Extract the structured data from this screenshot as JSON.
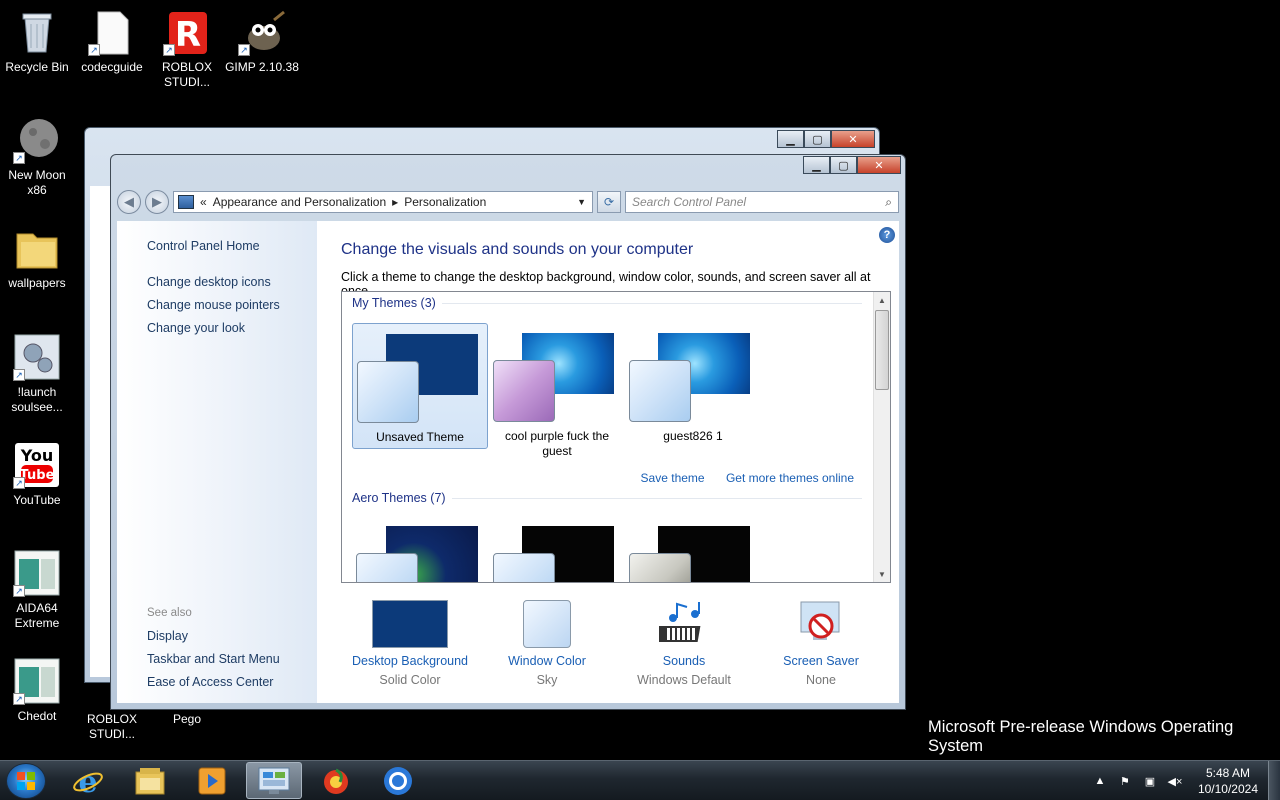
{
  "desktop": {
    "icons": [
      {
        "label": "Recycle Bin",
        "icon": "recycle-bin-icon"
      },
      {
        "label": "codecguide",
        "icon": "document-icon"
      },
      {
        "label": "ROBLOX STUDI...",
        "icon": "roblox-icon"
      },
      {
        "label": "GIMP 2.10.38",
        "icon": "gimp-icon"
      },
      {
        "label": "New Moon x86",
        "icon": "moon-icon"
      },
      {
        "label": "wallpapers",
        "icon": "folder-icon"
      },
      {
        "label": "!launch soulsee...",
        "icon": "gears-icon"
      },
      {
        "label": "YouTube",
        "icon": "youtube-icon"
      },
      {
        "label": "AIDA64 Extreme",
        "icon": "aida64-icon"
      },
      {
        "label": "Chedot",
        "icon": "chedot-icon"
      },
      {
        "label": "ROBLOX STUDI...",
        "icon": "roblox-icon"
      },
      {
        "label": "Pego",
        "icon": "app-icon"
      }
    ],
    "watermark": "Microsoft Pre-release Windows Operating System"
  },
  "window": {
    "address": {
      "chevron": "«",
      "crumb1": "Appearance and Personalization",
      "separator": "▸",
      "crumb2": "Personalization"
    },
    "search_placeholder": "Search Control Panel",
    "left_pane": {
      "home": "Control Panel Home",
      "links": [
        "Change desktop icons",
        "Change mouse pointers",
        "Change your look"
      ],
      "see_also_label": "See also",
      "see_also": [
        "Display",
        "Taskbar and Start Menu",
        "Ease of Access Center"
      ]
    },
    "main": {
      "title": "Change the visuals and sounds on your computer",
      "description": "Click a theme to change the desktop background, window color, sounds, and screen saver all at once.",
      "my_themes_header": "My Themes (3)",
      "my_themes": [
        {
          "name": "Unsaved Theme",
          "selected": true
        },
        {
          "name": "cool purple fuck the guest",
          "selected": false
        },
        {
          "name": "guest826 1",
          "selected": false
        }
      ],
      "save_theme": "Save theme",
      "get_more_themes": "Get more themes online",
      "aero_themes_header": "Aero Themes (7)",
      "bottom": [
        {
          "title": "Desktop Background",
          "value": "Solid Color",
          "icon": "desktop-background-icon"
        },
        {
          "title": "Window Color",
          "value": "Sky",
          "icon": "window-color-icon"
        },
        {
          "title": "Sounds",
          "value": "Windows Default",
          "icon": "sounds-icon"
        },
        {
          "title": "Screen Saver",
          "value": "None",
          "icon": "screen-saver-icon"
        }
      ]
    }
  },
  "taskbar": {
    "apps": [
      "internet-explorer-icon",
      "file-explorer-icon",
      "media-player-icon",
      "control-panel-icon",
      "browser-icon",
      "chrome-icon"
    ],
    "active_app": "control-panel-icon",
    "clock_time": "5:48 AM",
    "clock_date": "10/10/2024"
  },
  "colors": {
    "desktop_bg": "#000000",
    "link_blue": "#1a5fb4",
    "title_blue": "#1e3287",
    "close_red": "#c7422a"
  }
}
